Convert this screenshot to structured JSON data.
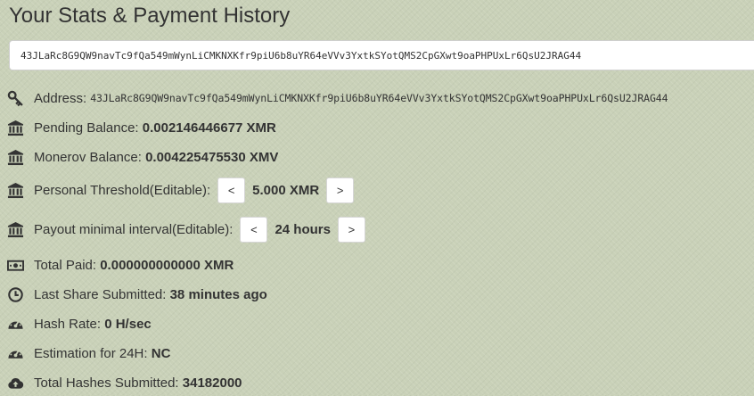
{
  "page": {
    "title": "Your Stats & Payment History"
  },
  "wallet_input": {
    "value": "43JLaRc8G9QW9navTc9fQa549mWynLiCMKNXKfr9piU6b8uYR64eVVv3YxtkSYotQMS2CpGXwt9oaPHPUxLr6QsU2JRAG44"
  },
  "stats": {
    "address": {
      "label": "Address:",
      "value": "43JLaRc8G9QW9navTc9fQa549mWynLiCMKNXKfr9piU6b8uYR64eVVv3YxtkSYotQMS2CpGXwt9oaPHPUxLr6QsU2JRAG44",
      "icon": "key-icon"
    },
    "pending_balance": {
      "label": "Pending Balance:",
      "value": "0.002146446677 XMR",
      "icon": "bank-icon"
    },
    "monerov_balance": {
      "label": "Monerov Balance:",
      "value": "0.004225475530 XMV",
      "icon": "bank-icon"
    },
    "personal_threshold": {
      "label": "Personal Threshold(Editable):",
      "value": "5.000 XMR",
      "decrease": "<",
      "increase": ">",
      "icon": "bank-icon"
    },
    "payout_interval": {
      "label": "Payout minimal interval(Editable):",
      "value": "24 hours",
      "decrease": "<",
      "increase": ">",
      "icon": "bank-icon"
    },
    "total_paid": {
      "label": "Total Paid:",
      "value": "0.000000000000 XMR",
      "icon": "money-icon"
    },
    "last_share": {
      "label": "Last Share Submitted:",
      "value": "38 minutes ago",
      "icon": "clock-icon"
    },
    "hash_rate": {
      "label": "Hash Rate:",
      "value": "0 H/sec",
      "icon": "dashboard-icon"
    },
    "estimation": {
      "label": "Estimation for 24H:",
      "value": "NC",
      "icon": "dashboard-icon"
    },
    "total_hashes": {
      "label": "Total Hashes Submitted:",
      "value": "34182000",
      "icon": "cloud-upload-icon"
    }
  },
  "colors": {
    "background": "#c9d1b8",
    "text": "#333333",
    "button_bg": "#ffffff"
  }
}
